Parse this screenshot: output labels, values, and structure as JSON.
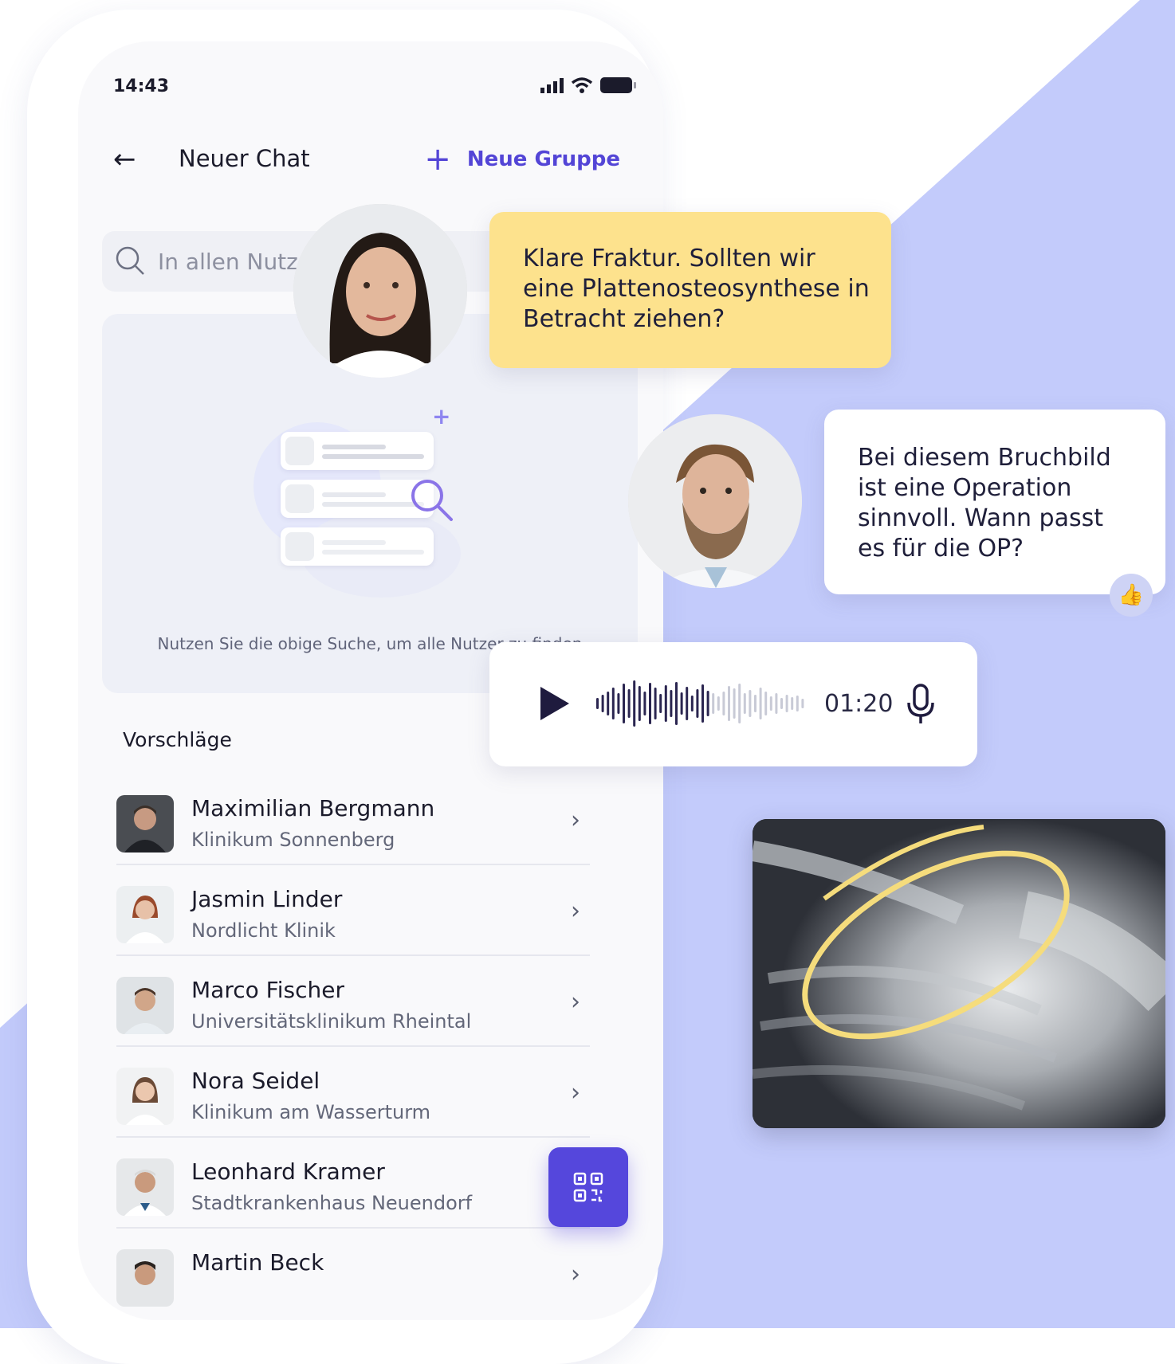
{
  "status": {
    "time": "14:43"
  },
  "header": {
    "title": "Neuer Chat",
    "new_group_label": "Neue Gruppe"
  },
  "search": {
    "placeholder": "In allen Nutzern"
  },
  "empty_state": {
    "caption": "Nutzen Sie die obige Suche, um alle Nutzer zu finden"
  },
  "suggestions": {
    "title": "Vorschläge",
    "items": [
      {
        "name": "Maximilian Bergmann",
        "org": "Klinikum Sonnenberg"
      },
      {
        "name": "Jasmin Linder",
        "org": "Nordlicht Klinik"
      },
      {
        "name": "Marco Fischer",
        "org": "Universitätsklinikum Rheintal"
      },
      {
        "name": "Nora Seidel",
        "org": "Klinikum am Wasserturm"
      },
      {
        "name": "Leonhard Kramer",
        "org": "Stadtkrankenhaus Neuendorf"
      },
      {
        "name": "Martin Beck",
        "org": ""
      }
    ]
  },
  "chat": {
    "message_1": "Klare Fraktur. Sollten wir eine Plattenosteosynthese in Betracht ziehen?",
    "message_2": "Bei diesem Bruchbild ist eine Operation sinnvoll. Wann passt es für die OP?",
    "reaction": "👍",
    "voice_duration": "01:20"
  },
  "colors": {
    "accent": "#5547dc",
    "yellow": "#fde28d",
    "background": "#c3cbfb"
  }
}
